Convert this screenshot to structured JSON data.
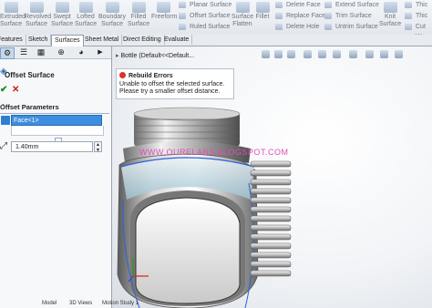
{
  "ribbon": {
    "buttons": [
      {
        "label": "Extruded\nSurface",
        "icon": "extruded-surface-icon"
      },
      {
        "label": "Revolved\nSurface",
        "icon": "revolved-surface-icon"
      },
      {
        "label": "Swept\nSurface",
        "icon": "swept-surface-icon"
      },
      {
        "label": "Lofted\nSurface",
        "icon": "lofted-surface-icon"
      },
      {
        "label": "Boundary\nSurface",
        "icon": "boundary-surface-icon"
      },
      {
        "label": "Filled\nSurface",
        "icon": "filled-surface-icon"
      },
      {
        "label": "Freeform",
        "icon": "freeform-icon"
      }
    ],
    "small_col1": [
      "Planar Surface",
      "Offset Surface",
      "Ruled Surface"
    ],
    "surface_flatten": "Surface\nFlatten",
    "fillet": "Fillet",
    "small_col2": [
      "Delete Face",
      "Replace Face",
      "Delete Hole"
    ],
    "small_col3": [
      "Extend Surface",
      "Trim Surface",
      "Untrim Surface"
    ],
    "knit": "Knit\nSurface",
    "small_col4": [
      "Thic",
      "Thic",
      "Cut W"
    ]
  },
  "tabs": [
    "Features",
    "Sketch",
    "Surfaces",
    "Sheet Metal",
    "Direct Editing",
    "Evaluate"
  ],
  "active_tab": "Surfaces",
  "panel": {
    "title": "Offset Surface",
    "section": "Offset Parameters",
    "face_item": "Face<1>",
    "distance": "1.40mm"
  },
  "viewport": {
    "tree_item": "Bottle  (Default<<Default...",
    "error": {
      "title": "Rebuild Errors",
      "line1": "Unable to offset the selected surface.",
      "line2": "Please try a smaller offset distance."
    },
    "watermark": "WWW.OURELABS.BLOGSPOT.COM"
  },
  "status_tabs": [
    "Model",
    "3D Views",
    "Motion Study 1"
  ],
  "colors": {
    "accent": "#3d8ede",
    "error": "#e0302a",
    "selection_edge": "#2b62d9",
    "watermark": "#e14fb4"
  }
}
